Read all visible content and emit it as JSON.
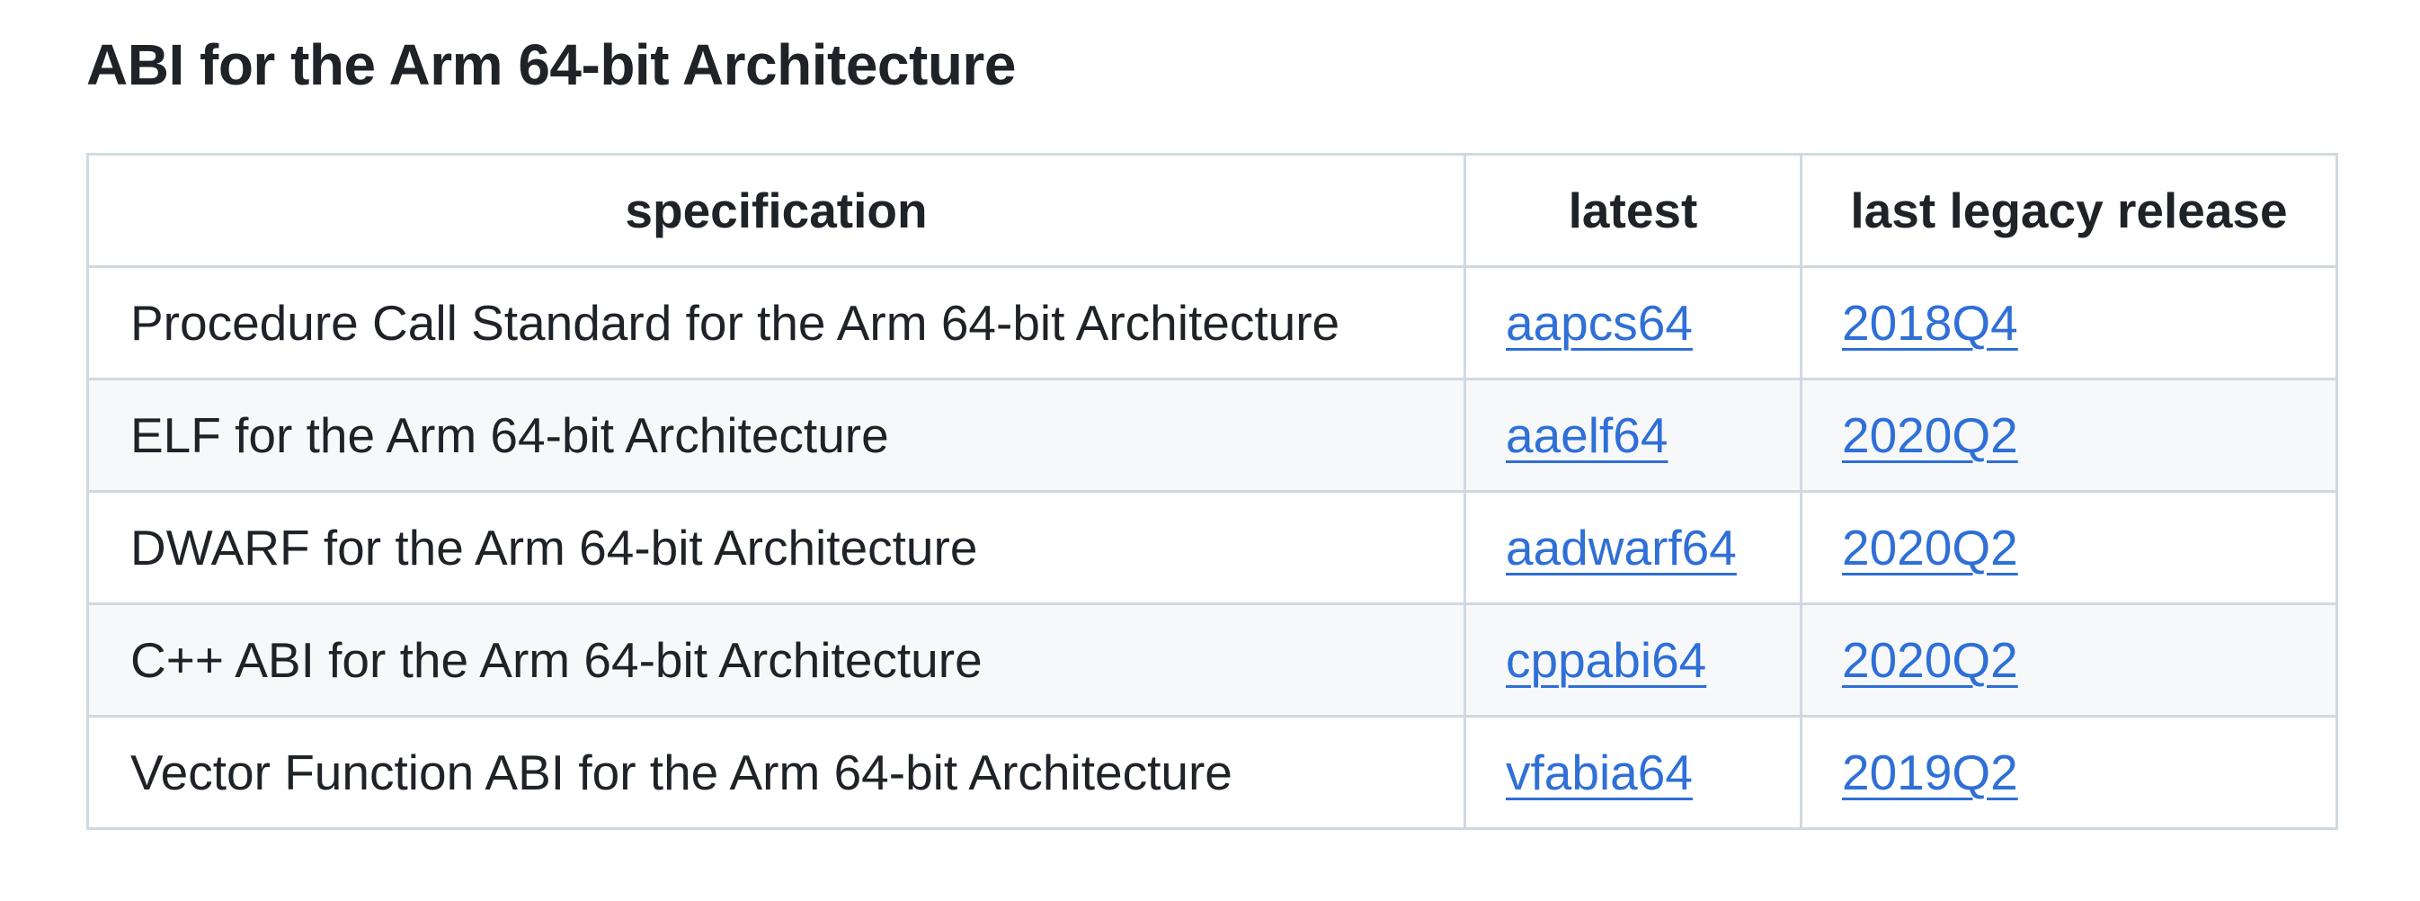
{
  "title": "ABI for the Arm 64-bit Architecture",
  "table": {
    "headers": [
      "specification",
      "latest",
      "last legacy release"
    ],
    "rows": [
      {
        "specification": "Procedure Call Standard for the Arm 64-bit Architecture",
        "latest": "aapcs64",
        "legacy": "2018Q4"
      },
      {
        "specification": "ELF for the Arm 64-bit Architecture",
        "latest": "aaelf64",
        "legacy": "2020Q2"
      },
      {
        "specification": "DWARF for the Arm 64-bit Architecture",
        "latest": "aadwarf64",
        "legacy": "2020Q2"
      },
      {
        "specification": "C++ ABI for the Arm 64-bit Architecture",
        "latest": "cppabi64",
        "legacy": "2020Q2"
      },
      {
        "specification": "Vector Function ABI for the Arm 64-bit Architecture",
        "latest": "vfabia64",
        "legacy": "2019Q2"
      }
    ]
  },
  "colors": {
    "text": "#1f2328",
    "link": "#2f6fd6",
    "border": "#d1d9e0",
    "row_alt": "#f6f8fa"
  }
}
